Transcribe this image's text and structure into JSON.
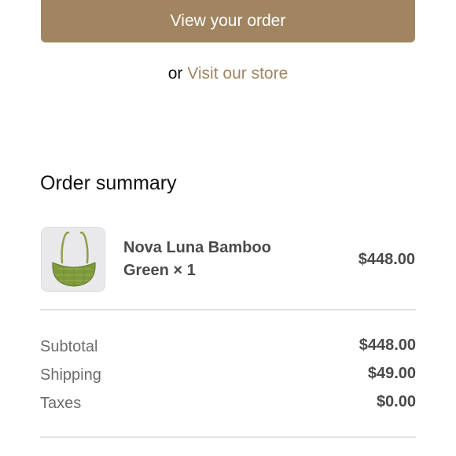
{
  "colors": {
    "accent": "#a08560",
    "text_dark": "#111111",
    "text_muted": "#6b6b6b",
    "value_text": "#4a4a4a",
    "divider": "#e3e3e3"
  },
  "actions": {
    "view_order_label": "View your order",
    "or_text": "or",
    "visit_store_label": "Visit our store"
  },
  "summary": {
    "title": "Order summary",
    "items": [
      {
        "name": "Nova Luna Bamboo Green × 1",
        "price": "$448.00",
        "icon": "bag-thumbnail"
      }
    ],
    "subtotal_label": "Subtotal",
    "subtotal_value": "$448.00",
    "shipping_label": "Shipping",
    "shipping_value": "$49.00",
    "taxes_label": "Taxes",
    "taxes_value": "$0.00"
  }
}
